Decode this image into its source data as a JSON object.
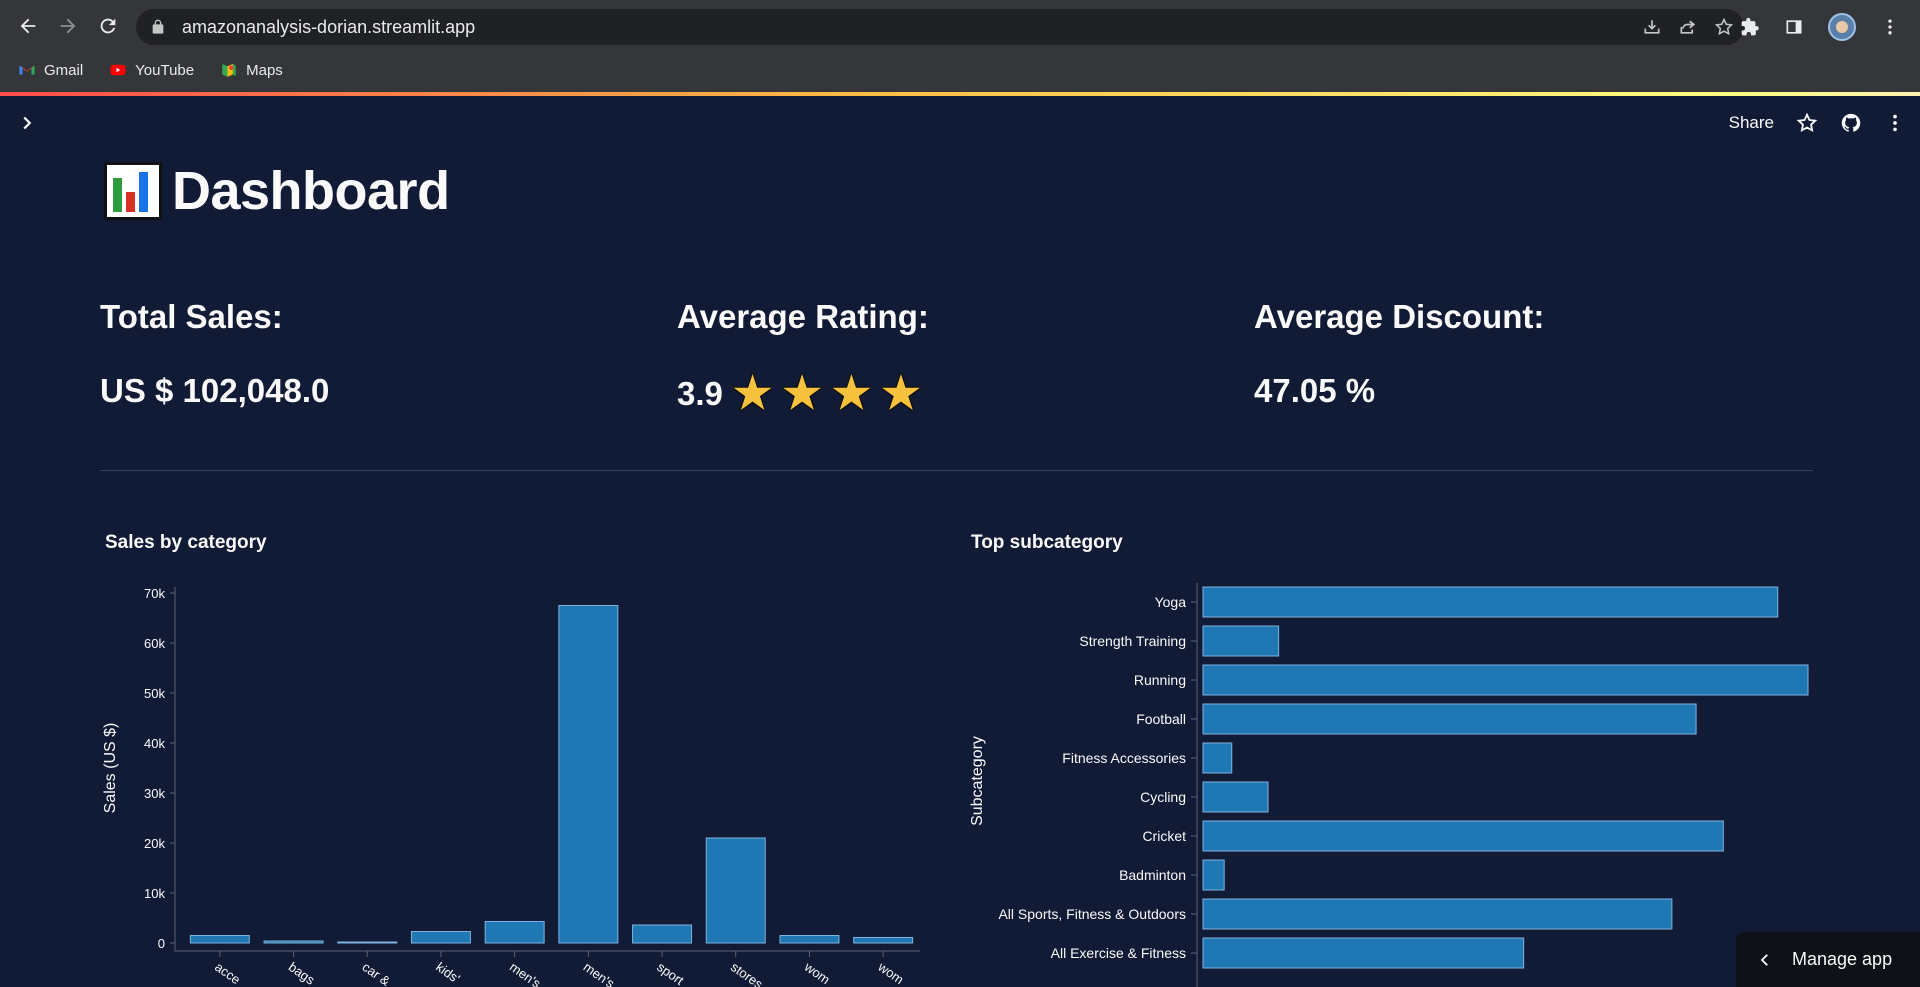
{
  "browser": {
    "url": "amazonanalysis-dorian.streamlit.app",
    "bookmarks": [
      {
        "label": "Gmail",
        "icon": "gmail-icon"
      },
      {
        "label": "YouTube",
        "icon": "youtube-icon"
      },
      {
        "label": "Maps",
        "icon": "maps-icon"
      }
    ]
  },
  "app": {
    "share_label": "Share",
    "title": "Dashboard",
    "title_icon": "bar-chart-emoji-icon",
    "metrics": [
      {
        "label": "Total Sales:",
        "value": "US $ 102,048.0"
      },
      {
        "label": "Average Rating:",
        "value": "3.9",
        "stars": 4,
        "star_char": "★"
      },
      {
        "label": "Average Discount:",
        "value": "47.05 %"
      }
    ],
    "manage_app_label": "Manage app",
    "colors": {
      "background": "#111b35",
      "bar": "#1f77b4",
      "star": "#f6c13d"
    }
  },
  "chart_data": [
    {
      "type": "bar",
      "title": "Sales by category",
      "ylabel": "Sales (US $)",
      "xlabel": "",
      "ylim": [
        0,
        70000
      ],
      "yticks": [
        0,
        10000,
        20000,
        30000,
        40000,
        50000,
        60000,
        70000
      ],
      "ytick_labels": [
        "0",
        "10k",
        "20k",
        "30k",
        "40k",
        "50k",
        "60k",
        "70k"
      ],
      "categories": [
        "acce",
        "bags",
        "car &",
        "kids'",
        "men's",
        "men's",
        "sport",
        "stores",
        "wom",
        "wom"
      ],
      "values": [
        1500,
        400,
        200,
        2300,
        4300,
        67500,
        3600,
        21000,
        1500,
        1100
      ]
    },
    {
      "type": "bar",
      "orientation": "horizontal",
      "title": "Top subcategory",
      "ylabel": "Subcategory",
      "categories": [
        "Yoga",
        "Strength Training",
        "Running",
        "Football",
        "Fitness Accessories",
        "Cycling",
        "Cricket",
        "Badminton",
        "All Sports, Fitness & Outdoors",
        "All Exercise & Fitness"
      ],
      "values": [
        19000,
        2500,
        20000,
        16300,
        950,
        2150,
        17200,
        700,
        15500,
        10600
      ]
    }
  ]
}
